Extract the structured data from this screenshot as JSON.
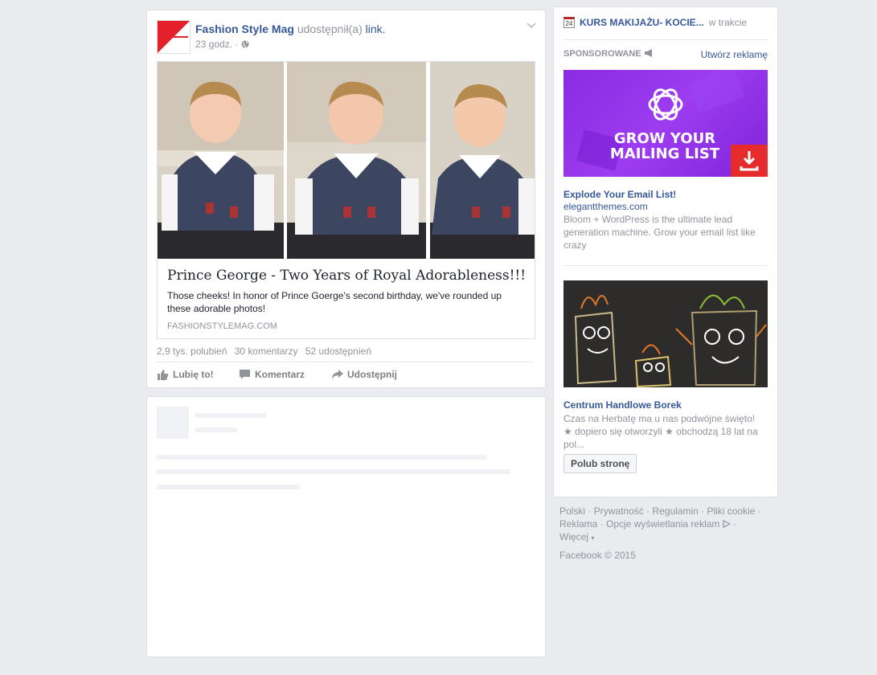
{
  "post": {
    "author": "Fashion Style Mag",
    "action_text": "udostępnił(a)",
    "action_link": "link.",
    "time": "23 godz. ·",
    "attachment": {
      "title": "Prince George - Two Years of Royal Adorableness!!!",
      "description": "Those cheeks! In honor of Prince Goerge's second birthday, we've rounded up these adorable photos!",
      "domain": "FASHIONSTYLEMAG.COM"
    },
    "stats": {
      "likes": "2,9 tys. polubień",
      "comments": "30 komentarzy",
      "shares": "52 udostępnień"
    },
    "actions": {
      "like": "Lubię to!",
      "comment": "Komentarz",
      "share": "Udostępnij"
    }
  },
  "sidebar": {
    "upcoming_event": {
      "calendar_day": "24",
      "name": "KURS MAKIJAŻU- KOCIE...",
      "status": "w trakcie"
    },
    "sponsored_label": "SPONSOROWANE",
    "create_ad": "Utwórz reklamę",
    "ads": [
      {
        "image_text_line1": "GROW YOUR",
        "image_text_line2": "MAILING LIST",
        "title": "Explode Your Email List!",
        "domain": "elegantthemes.com",
        "text": "Bloom + WordPress is the ultimate lead generation machine. Grow your email list like crazy"
      },
      {
        "title": "Centrum Handlowe Borek",
        "text": "Czas na Herbatę ma u nas podwójne święto! ★ dopiero się otworzyli ★ obchodzą 18 lat na pol...",
        "button": "Polub stronę"
      }
    ]
  },
  "footer": {
    "links": [
      "Polski",
      "Prywatność",
      "Regulamin",
      "Pliki cookie",
      "Reklama",
      "Opcje wyświetlania reklam"
    ],
    "more": "Więcej",
    "copyright": "Facebook © 2015"
  },
  "colors": {
    "link_blue": "#365899",
    "muted_grey": "#90949c",
    "page_bg": "#e9ebee",
    "ad_purple": "#8a2be2",
    "ad_red": "#e52b2b"
  }
}
